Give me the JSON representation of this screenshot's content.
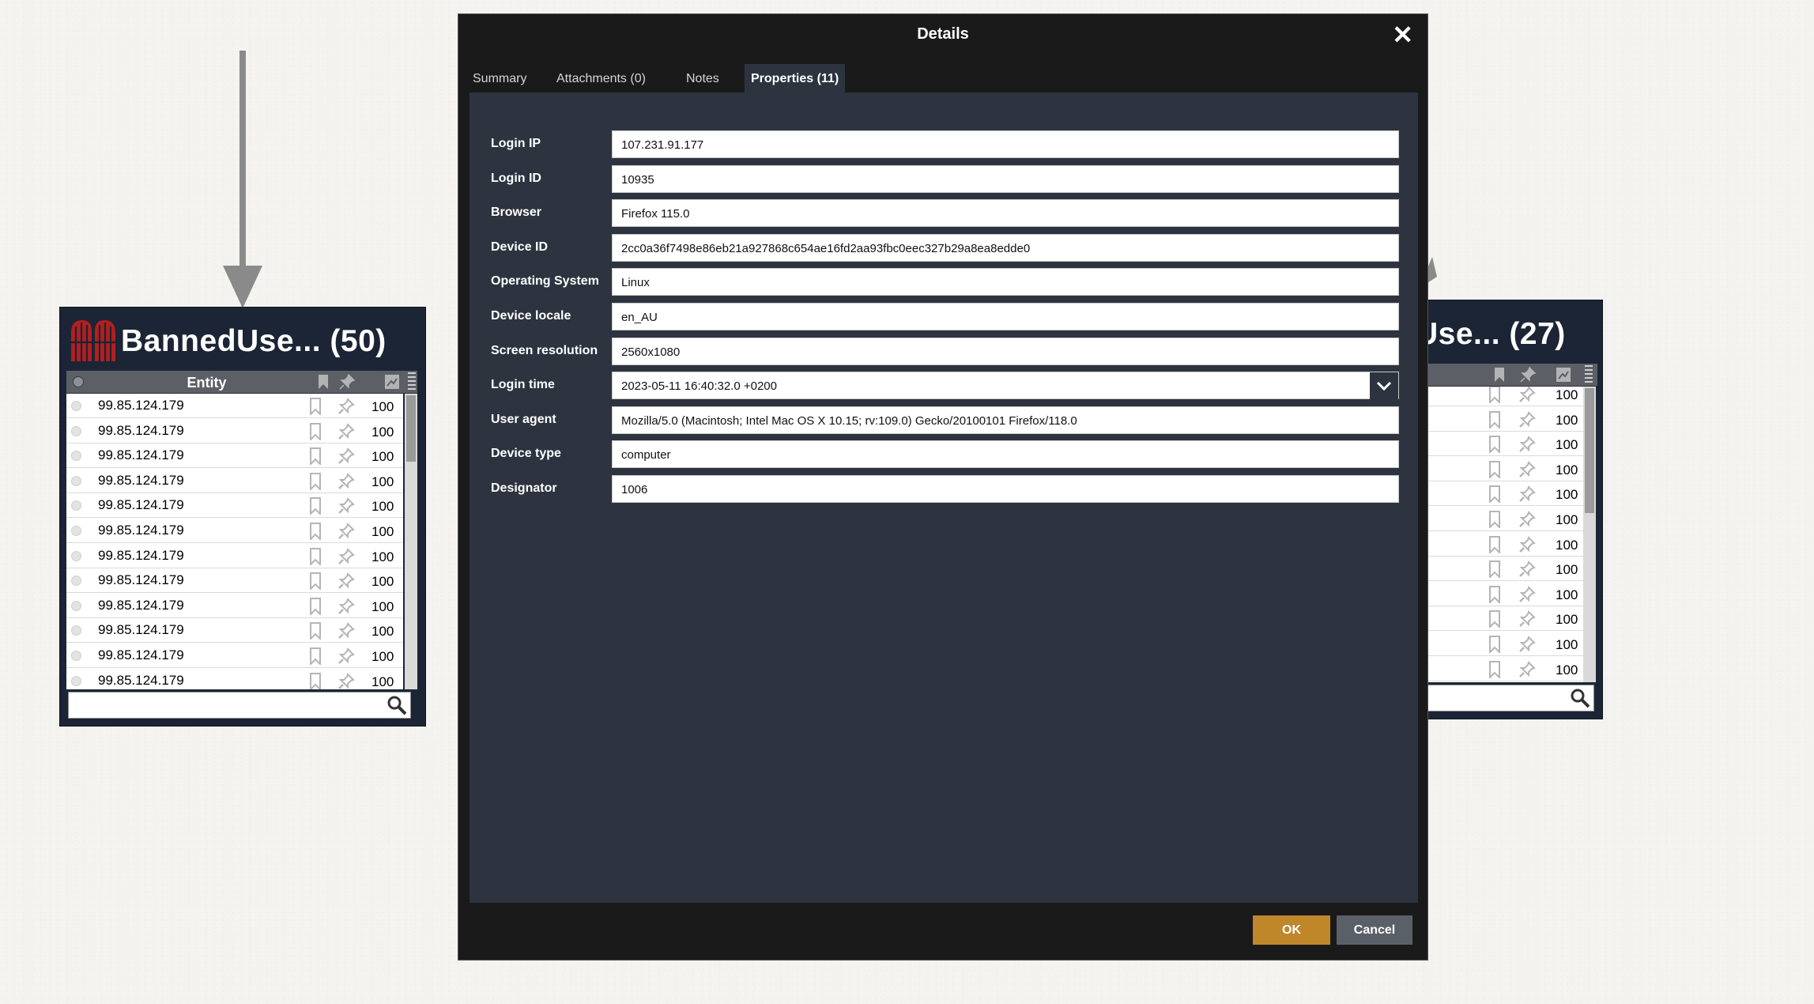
{
  "left_panel": {
    "title": "BannedUse... (50)",
    "column_header": "Entity",
    "rows": [
      {
        "value": "99.85.124.179",
        "score": "100"
      },
      {
        "value": "99.85.124.179",
        "score": "100"
      },
      {
        "value": "99.85.124.179",
        "score": "100"
      },
      {
        "value": "99.85.124.179",
        "score": "100"
      },
      {
        "value": "99.85.124.179",
        "score": "100"
      },
      {
        "value": "99.85.124.179",
        "score": "100"
      },
      {
        "value": "99.85.124.179",
        "score": "100"
      },
      {
        "value": "99.85.124.179",
        "score": "100"
      },
      {
        "value": "99.85.124.179",
        "score": "100"
      },
      {
        "value": "99.85.124.179",
        "score": "100"
      },
      {
        "value": "99.85.124.179",
        "score": "100"
      },
      {
        "value": "99.85.124.179",
        "score": "100"
      }
    ],
    "search_value": ""
  },
  "right_panel": {
    "title": "Use... (27)",
    "rows": [
      {
        "score": "100"
      },
      {
        "score": "100"
      },
      {
        "score": "100"
      },
      {
        "score": "100"
      },
      {
        "score": "100"
      },
      {
        "score": "100"
      },
      {
        "score": "100"
      },
      {
        "score": "100"
      },
      {
        "score": "100"
      },
      {
        "score": "100"
      },
      {
        "score": "100"
      },
      {
        "score": "100"
      }
    ],
    "search_value": ""
  },
  "dialog": {
    "title": "Details",
    "close_icon": "close-icon",
    "tabs": [
      {
        "label": "Summary",
        "active": false
      },
      {
        "label": "Attachments (0)",
        "active": false
      },
      {
        "label": "Notes",
        "active": false
      },
      {
        "label": "Properties (11)",
        "active": true
      }
    ],
    "properties": [
      {
        "label": "Login IP",
        "value": "107.231.91.177"
      },
      {
        "label": "Login ID",
        "value": "10935"
      },
      {
        "label": "Browser",
        "value": "Firefox 115.0"
      },
      {
        "label": "Device ID",
        "value": "2cc0a36f7498e86eb21a927868c654ae16fd2aa93fbc0eec327b29a8ea8edde0"
      },
      {
        "label": "Operating System",
        "value": "Linux"
      },
      {
        "label": "Device locale",
        "value": "en_AU"
      },
      {
        "label": "Screen resolution",
        "value": "2560x1080"
      },
      {
        "label": "Login time",
        "value": "2023-05-11 16:40:32.0 +0200",
        "has_dropdown": true
      },
      {
        "label": "User agent",
        "value": "Mozilla/5.0 (Macintosh; Intel Mac OS X 10.15; rv:109.0) Gecko/20100101 Firefox/118.0"
      },
      {
        "label": "Device type",
        "value": "computer"
      },
      {
        "label": "Designator",
        "value": "1006"
      }
    ],
    "ok_label": "OK",
    "cancel_label": "Cancel"
  },
  "colors": {
    "panel_bg": "#1b2535",
    "dialog_bg": "#1a1a1a",
    "content_bg": "#2d3440",
    "ok_button": "#c0862a",
    "cancel_button": "#5a6068",
    "logo_red": "#b02020"
  }
}
